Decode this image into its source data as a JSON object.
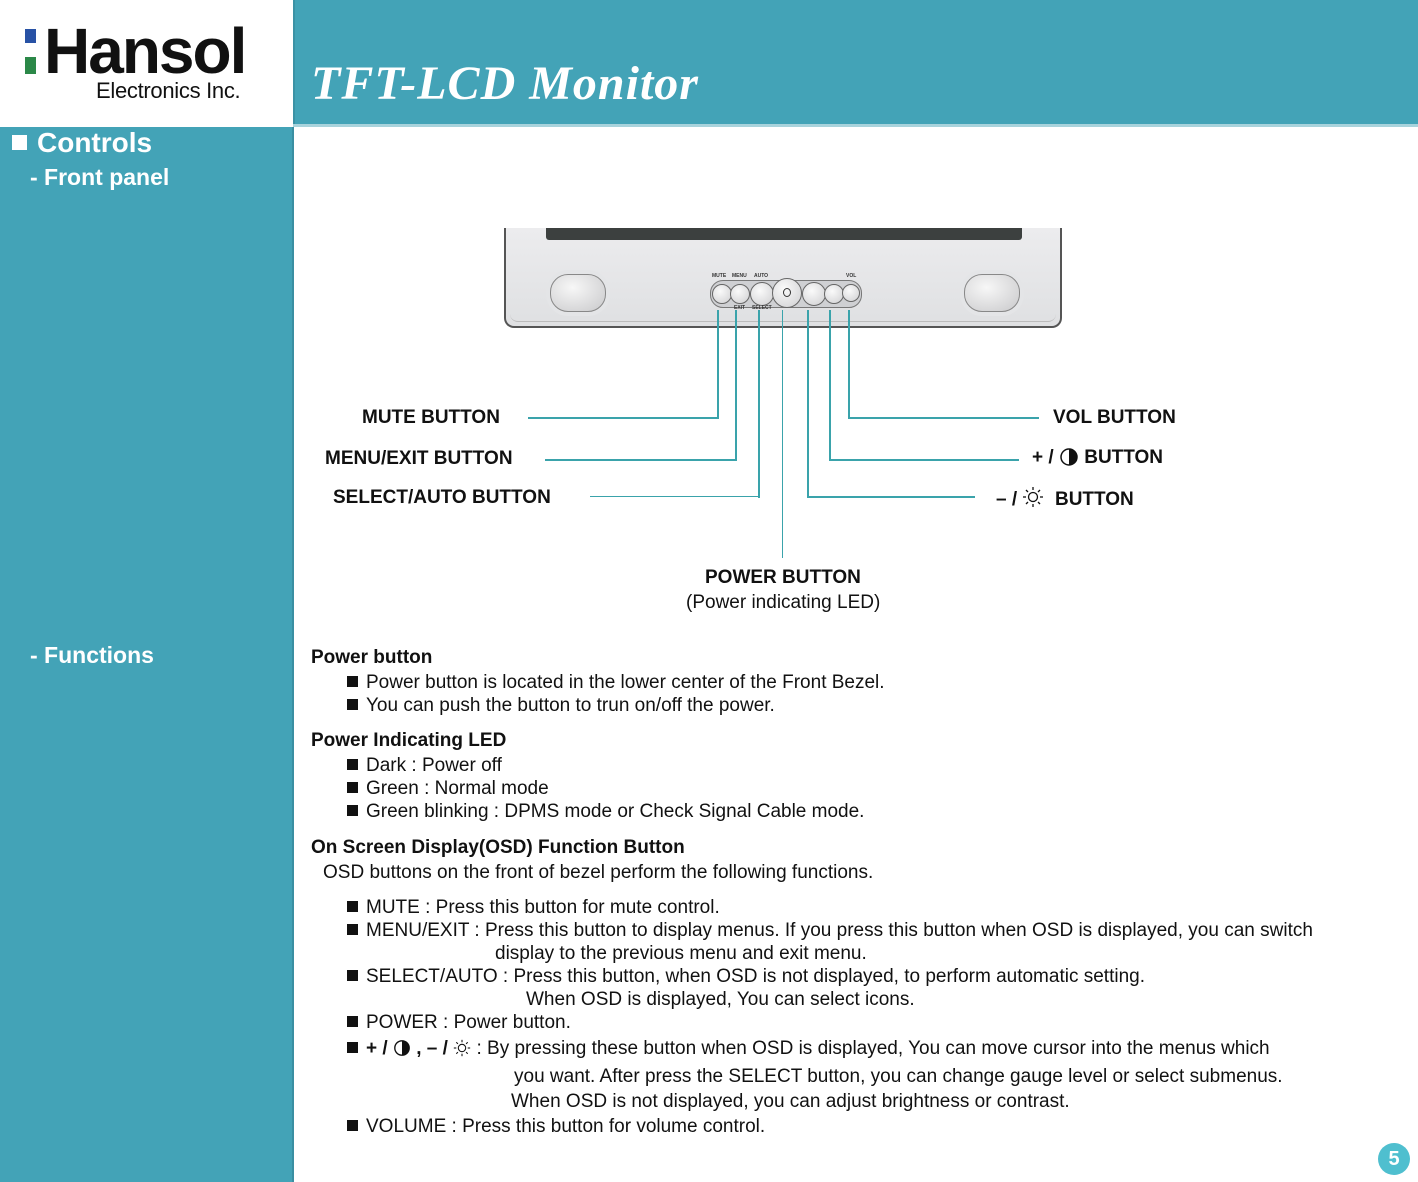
{
  "header": {
    "brand": "Hansol",
    "brand_sub": "Electronics Inc.",
    "title": "TFT-LCD Monitor",
    "accent_color": "#43a3b7"
  },
  "sidebar": {
    "section": "Controls",
    "front_panel": "- Front panel",
    "functions": "- Functions"
  },
  "diagram": {
    "bezel_labels": {
      "mute": "MUTE",
      "menu": "MENU",
      "auto": "AUTO",
      "vol": "VOL",
      "exit": "EXIT",
      "select": "SELECT"
    },
    "callouts": {
      "mute": "MUTE BUTTON",
      "menu_exit": "MENU/EXIT BUTTON",
      "select_auto": "SELECT/AUTO BUTTON",
      "vol": "VOL BUTTON",
      "plus_contrast": "BUTTON",
      "minus_brightness": "BUTTON",
      "plus_sign": "+ /",
      "minus_sign": "– /",
      "power": "POWER BUTTON",
      "power_sub": "(Power indicating LED)"
    }
  },
  "functions": {
    "power_button": {
      "heading": "Power button",
      "items": [
        "Power button is located in the lower center of the Front Bezel.",
        "You can push the button to trun on/off the power."
      ]
    },
    "power_led": {
      "heading": "Power Indicating LED",
      "items": [
        "Dark : Power off",
        "Green : Normal mode",
        "Green blinking : DPMS mode or Check Signal Cable mode."
      ]
    },
    "osd": {
      "heading": "On Screen Display(OSD) Function Button",
      "intro": "OSD buttons on the front of bezel perform the following functions.",
      "mute": "MUTE : Press this button for mute control.",
      "menu_exit_1": "MENU/EXIT : Press this button to display menus. If you press this button when OSD is displayed, you can switch",
      "menu_exit_2": "display to the previous menu and exit menu.",
      "select_auto_1": "SELECT/AUTO : Press this button, when OSD is not displayed, to perform automatic setting.",
      "select_auto_2": "When OSD is displayed, You can select icons.",
      "power": "POWER : Power button.",
      "adjust_prefix_plus": "+ /",
      "adjust_prefix_sep": ", – /",
      "adjust_1": ": By pressing these button when OSD is displayed, You can move cursor into the menus which",
      "adjust_2": "you want. After press the SELECT button, you can change gauge level or select submenus.",
      "adjust_3": "When OSD is not displayed, you can adjust brightness or contrast.",
      "volume": "VOLUME : Press this button for volume control."
    }
  },
  "page_number": "5"
}
